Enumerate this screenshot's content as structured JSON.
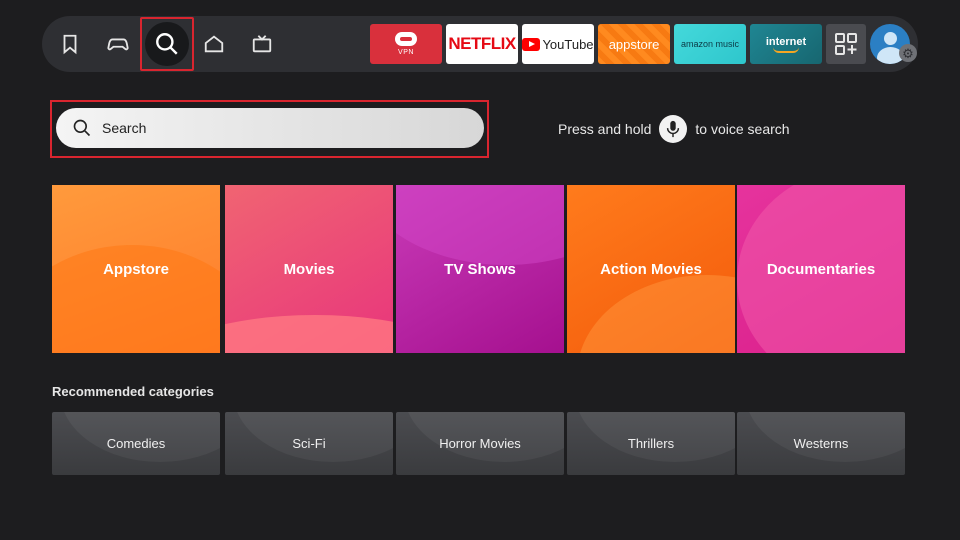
{
  "nav": {
    "icons": [
      "bookmark-icon",
      "gamepad-icon",
      "search-icon",
      "home-icon",
      "live-tv-icon"
    ],
    "apps": {
      "vpn_label": "VPN",
      "netflix_label": "NETFLIX",
      "youtube_label": "YouTube",
      "appstore_label": "appstore",
      "music_label": "amazon music",
      "internet_label": "internet"
    },
    "apps_grid_icon": "apps-grid-icon",
    "profile_icon": "profile-avatar",
    "settings_icon": "gear-icon"
  },
  "search": {
    "placeholder": "Search",
    "voice_hint_before": "Press and hold",
    "voice_hint_after": "to voice search"
  },
  "categories": [
    {
      "label": "Appstore",
      "color": "#ff8c33"
    },
    {
      "label": "Movies",
      "color": "#ec4a78"
    },
    {
      "label": "TV Shows",
      "color": "#b4209f"
    },
    {
      "label": "Action Movies",
      "color": "#f86a14"
    },
    {
      "label": "Documentaries",
      "color": "#e02a93"
    }
  ],
  "recommended": {
    "title": "Recommended categories",
    "items": [
      "Comedies",
      "Sci-Fi",
      "Horror Movies",
      "Thrillers",
      "Westerns"
    ]
  },
  "colors": {
    "background": "#1d1d1f",
    "focus_outline": "#d9252f",
    "nav_bar": "#2e2f33"
  }
}
